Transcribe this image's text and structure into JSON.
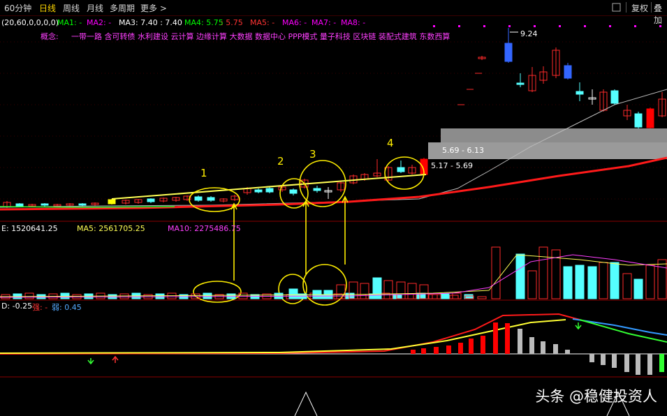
{
  "toolbar": {
    "timeframe": "60分钟",
    "tabs": [
      "日线",
      "周线",
      "月线",
      "多周期",
      "更多 >"
    ],
    "right_buttons": [
      "复权",
      "叠加"
    ],
    "nav_icon": "square-outline-icon"
  },
  "ma_row": {
    "params": "(20,60,0,0,0,0)",
    "items": [
      {
        "label": "MA1: -",
        "color": "#00ff00"
      },
      {
        "label": "MA2: -",
        "color": "#ff00ff"
      },
      {
        "label": "MA3: 7.40 : 7.40",
        "color": "#ffffff"
      },
      {
        "label": "MA4: 5.75",
        "color": "#00ff00"
      },
      {
        "label": ": 5.75",
        "color": "#ff3333"
      },
      {
        "label": "MA5: -",
        "color": "#ff3333"
      },
      {
        "label": "MA6: -",
        "color": "#ff00ff"
      },
      {
        "label": "MA7: -",
        "color": "#ff00ff"
      },
      {
        "label": "MA8: -",
        "color": "#ff00ff"
      }
    ]
  },
  "concept": {
    "label": "概念:",
    "text": "一带一路 含可转债 水利建设 云计算 边缘计算 大数据 数据中心 PPP模式 量子科技 区块链 装配式建筑 东数西算"
  },
  "price_chart": {
    "high_label": "9.24",
    "zones": [
      "5.69 - 6.13",
      "5.17 - 5.69"
    ],
    "markers": [
      "1",
      "2",
      "3",
      "4"
    ]
  },
  "volume": {
    "vol_text": "E: 1520641.25",
    "ma5": "MA5: 2561705.25",
    "ma10": "MA10: 2275486.75"
  },
  "indicator": {
    "value": "D: -0.25",
    "strong": "强: -",
    "weak": "弱: 0.45"
  },
  "watermark": "头条 @稳健投资人",
  "colors": {
    "up": "#ff2a2a",
    "down": "#55ffff",
    "ma_yellow": "#ffff33",
    "annot": "#ffee00"
  }
}
